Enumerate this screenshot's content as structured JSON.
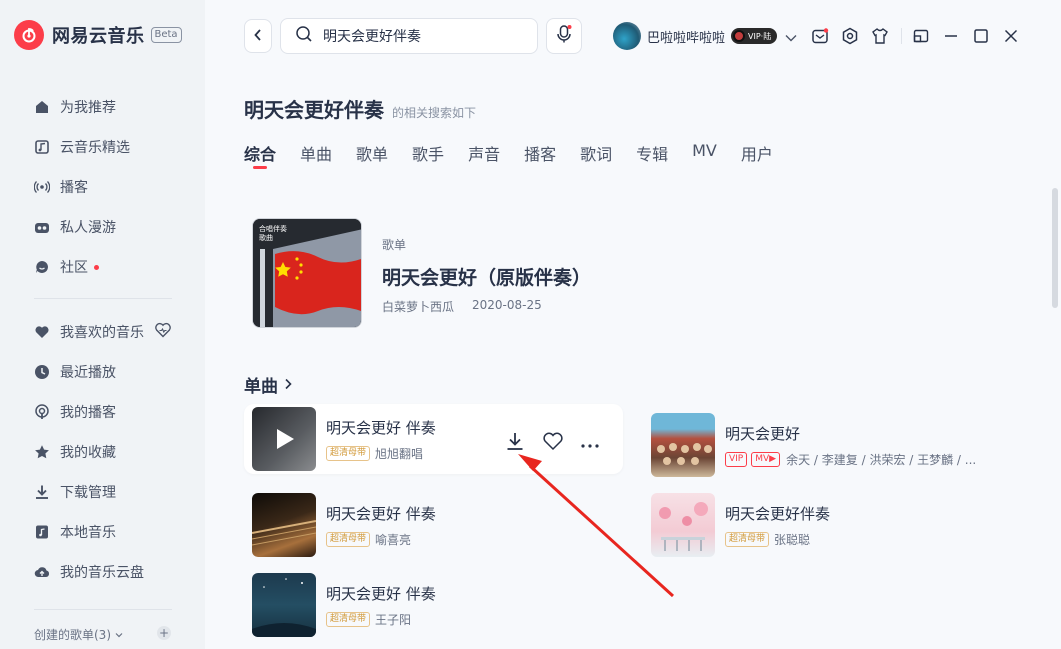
{
  "app": {
    "name": "网易云音乐",
    "badge": "Beta",
    "brand_color": "#fc3d49"
  },
  "sidebar": {
    "primary": [
      {
        "label": "为我推荐",
        "icon": "home-icon"
      },
      {
        "label": "云音乐精选",
        "icon": "music-note-icon"
      },
      {
        "label": "播客",
        "icon": "podcast-icon"
      },
      {
        "label": "私人漫游",
        "icon": "radio-icon"
      },
      {
        "label": "社区",
        "icon": "chat-icon"
      }
    ],
    "secondary": [
      {
        "label": "我喜欢的音乐",
        "icon": "heart-icon"
      },
      {
        "label": "最近播放",
        "icon": "clock-icon"
      },
      {
        "label": "我的播客",
        "icon": "podcast-icon"
      },
      {
        "label": "我的收藏",
        "icon": "star-icon"
      },
      {
        "label": "下载管理",
        "icon": "download-icon"
      },
      {
        "label": "本地音乐",
        "icon": "folder-icon"
      },
      {
        "label": "我的音乐云盘",
        "icon": "cloud-icon"
      }
    ],
    "created_playlists": "创建的歌单(3)"
  },
  "header": {
    "search_value": "明天会更好伴奏",
    "username": "巴啦啦哔啦啦",
    "vip_label": "VIP·陆"
  },
  "results": {
    "query_title": "明天会更好伴奏",
    "subtitle": "的相关搜索如下",
    "tabs": [
      "综合",
      "单曲",
      "歌单",
      "歌手",
      "声音",
      "播客",
      "歌词",
      "专辑",
      "MV",
      "用户"
    ],
    "active_tab": 0,
    "playlist": {
      "type": "歌单",
      "name": "明天会更好（原版伴奏）",
      "creator": "白菜萝卜西瓜",
      "date": "2020-08-25",
      "cover_text": "合唱伴奏 歌曲"
    },
    "songs_section": "单曲",
    "songs": [
      {
        "title": "明天会更好 伴奏",
        "quality": "超清母带",
        "artist": "旭旭翻唱"
      },
      {
        "title": "明天会更好 伴奏",
        "quality": "超清母带",
        "artist": "喻喜亮"
      },
      {
        "title": "明天会更好 伴奏",
        "quality": "超清母带",
        "artist": "王子阳"
      },
      {
        "title": "明天会更好",
        "vip": "VIP",
        "mv": "MV▶",
        "artist": "余天 / 李建复 / 洪荣宏 / 王梦麟 / ..."
      },
      {
        "title": "明天会更好伴奏",
        "quality": "超清母带",
        "artist": "张聪聪"
      }
    ]
  }
}
